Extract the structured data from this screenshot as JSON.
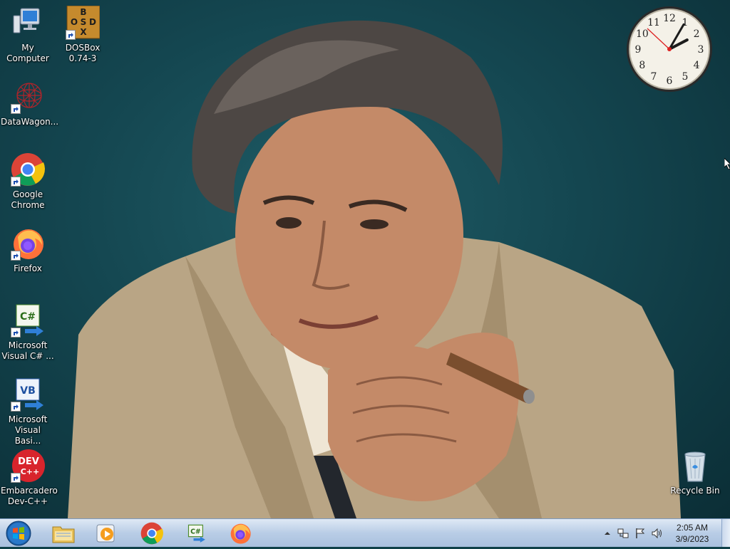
{
  "desktop": {
    "icons": [
      {
        "label": "My Computer",
        "icon": "computer-icon"
      },
      {
        "label": "DOSBox 0.74-3",
        "icon": "dosbox-icon"
      },
      {
        "label": "DataWagon...",
        "icon": "datawagon-icon"
      },
      {
        "label": "Google Chrome",
        "icon": "chrome-icon"
      },
      {
        "label": "Firefox",
        "icon": "firefox-icon"
      },
      {
        "label": "Microsoft Visual C# ...",
        "icon": "visual-csharp-icon"
      },
      {
        "label": "Microsoft Visual Basi...",
        "icon": "visual-basic-icon"
      },
      {
        "label": "Embarcadero Dev-C++",
        "icon": "devcpp-icon"
      },
      {
        "label": "Recycle Bin",
        "icon": "recycle-bin-icon"
      }
    ],
    "dosbox_letters": [
      "B",
      "O",
      "S",
      "D",
      "X"
    ],
    "csharp_badge": "C#",
    "vb_badge": "VB",
    "devcpp_badge": "DEV",
    "devcpp_sub": "C++"
  },
  "clock_gadget": {
    "numbers": [
      "12",
      "1",
      "2",
      "3",
      "4",
      "5",
      "6",
      "7",
      "8",
      "9",
      "10",
      "11"
    ],
    "hour": 2,
    "minute": 5
  },
  "taskbar": {
    "start": "start-orb-icon",
    "pinned": [
      {
        "name": "explorer",
        "icon": "folder-icon"
      },
      {
        "name": "media-player",
        "icon": "media-player-icon"
      },
      {
        "name": "chrome",
        "icon": "chrome-icon"
      },
      {
        "name": "visual-csharp",
        "icon": "visual-csharp-icon"
      },
      {
        "name": "firefox",
        "icon": "firefox-icon"
      }
    ],
    "tray": {
      "time": "2:05 AM",
      "date": "3/9/2023",
      "icons": [
        "show-hidden-icons-arrow",
        "network-icon",
        "action-center-flag-icon",
        "volume-icon"
      ]
    }
  },
  "colors": {
    "wallpaper_bg": "#144650",
    "taskbar": "#b9cde6",
    "coat": "#b9a585"
  }
}
